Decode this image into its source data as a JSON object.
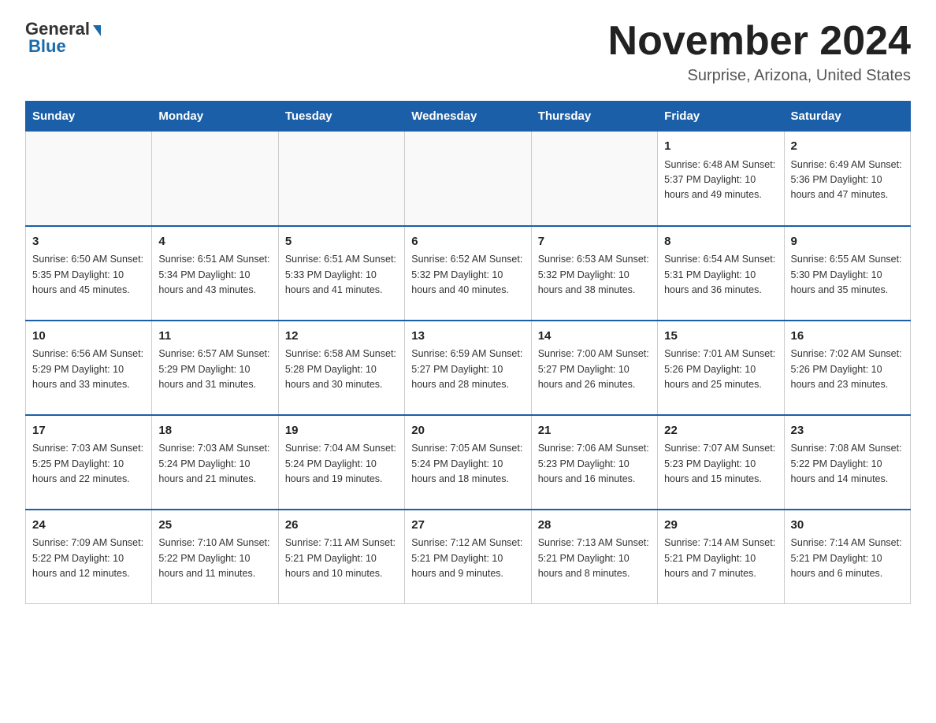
{
  "header": {
    "logo_general": "General",
    "logo_blue": "Blue",
    "month_title": "November 2024",
    "location": "Surprise, Arizona, United States"
  },
  "days_of_week": [
    "Sunday",
    "Monday",
    "Tuesday",
    "Wednesday",
    "Thursday",
    "Friday",
    "Saturday"
  ],
  "weeks": [
    [
      {
        "day": "",
        "info": ""
      },
      {
        "day": "",
        "info": ""
      },
      {
        "day": "",
        "info": ""
      },
      {
        "day": "",
        "info": ""
      },
      {
        "day": "",
        "info": ""
      },
      {
        "day": "1",
        "info": "Sunrise: 6:48 AM\nSunset: 5:37 PM\nDaylight: 10 hours and 49 minutes."
      },
      {
        "day": "2",
        "info": "Sunrise: 6:49 AM\nSunset: 5:36 PM\nDaylight: 10 hours and 47 minutes."
      }
    ],
    [
      {
        "day": "3",
        "info": "Sunrise: 6:50 AM\nSunset: 5:35 PM\nDaylight: 10 hours and 45 minutes."
      },
      {
        "day": "4",
        "info": "Sunrise: 6:51 AM\nSunset: 5:34 PM\nDaylight: 10 hours and 43 minutes."
      },
      {
        "day": "5",
        "info": "Sunrise: 6:51 AM\nSunset: 5:33 PM\nDaylight: 10 hours and 41 minutes."
      },
      {
        "day": "6",
        "info": "Sunrise: 6:52 AM\nSunset: 5:32 PM\nDaylight: 10 hours and 40 minutes."
      },
      {
        "day": "7",
        "info": "Sunrise: 6:53 AM\nSunset: 5:32 PM\nDaylight: 10 hours and 38 minutes."
      },
      {
        "day": "8",
        "info": "Sunrise: 6:54 AM\nSunset: 5:31 PM\nDaylight: 10 hours and 36 minutes."
      },
      {
        "day": "9",
        "info": "Sunrise: 6:55 AM\nSunset: 5:30 PM\nDaylight: 10 hours and 35 minutes."
      }
    ],
    [
      {
        "day": "10",
        "info": "Sunrise: 6:56 AM\nSunset: 5:29 PM\nDaylight: 10 hours and 33 minutes."
      },
      {
        "day": "11",
        "info": "Sunrise: 6:57 AM\nSunset: 5:29 PM\nDaylight: 10 hours and 31 minutes."
      },
      {
        "day": "12",
        "info": "Sunrise: 6:58 AM\nSunset: 5:28 PM\nDaylight: 10 hours and 30 minutes."
      },
      {
        "day": "13",
        "info": "Sunrise: 6:59 AM\nSunset: 5:27 PM\nDaylight: 10 hours and 28 minutes."
      },
      {
        "day": "14",
        "info": "Sunrise: 7:00 AM\nSunset: 5:27 PM\nDaylight: 10 hours and 26 minutes."
      },
      {
        "day": "15",
        "info": "Sunrise: 7:01 AM\nSunset: 5:26 PM\nDaylight: 10 hours and 25 minutes."
      },
      {
        "day": "16",
        "info": "Sunrise: 7:02 AM\nSunset: 5:26 PM\nDaylight: 10 hours and 23 minutes."
      }
    ],
    [
      {
        "day": "17",
        "info": "Sunrise: 7:03 AM\nSunset: 5:25 PM\nDaylight: 10 hours and 22 minutes."
      },
      {
        "day": "18",
        "info": "Sunrise: 7:03 AM\nSunset: 5:24 PM\nDaylight: 10 hours and 21 minutes."
      },
      {
        "day": "19",
        "info": "Sunrise: 7:04 AM\nSunset: 5:24 PM\nDaylight: 10 hours and 19 minutes."
      },
      {
        "day": "20",
        "info": "Sunrise: 7:05 AM\nSunset: 5:24 PM\nDaylight: 10 hours and 18 minutes."
      },
      {
        "day": "21",
        "info": "Sunrise: 7:06 AM\nSunset: 5:23 PM\nDaylight: 10 hours and 16 minutes."
      },
      {
        "day": "22",
        "info": "Sunrise: 7:07 AM\nSunset: 5:23 PM\nDaylight: 10 hours and 15 minutes."
      },
      {
        "day": "23",
        "info": "Sunrise: 7:08 AM\nSunset: 5:22 PM\nDaylight: 10 hours and 14 minutes."
      }
    ],
    [
      {
        "day": "24",
        "info": "Sunrise: 7:09 AM\nSunset: 5:22 PM\nDaylight: 10 hours and 12 minutes."
      },
      {
        "day": "25",
        "info": "Sunrise: 7:10 AM\nSunset: 5:22 PM\nDaylight: 10 hours and 11 minutes."
      },
      {
        "day": "26",
        "info": "Sunrise: 7:11 AM\nSunset: 5:21 PM\nDaylight: 10 hours and 10 minutes."
      },
      {
        "day": "27",
        "info": "Sunrise: 7:12 AM\nSunset: 5:21 PM\nDaylight: 10 hours and 9 minutes."
      },
      {
        "day": "28",
        "info": "Sunrise: 7:13 AM\nSunset: 5:21 PM\nDaylight: 10 hours and 8 minutes."
      },
      {
        "day": "29",
        "info": "Sunrise: 7:14 AM\nSunset: 5:21 PM\nDaylight: 10 hours and 7 minutes."
      },
      {
        "day": "30",
        "info": "Sunrise: 7:14 AM\nSunset: 5:21 PM\nDaylight: 10 hours and 6 minutes."
      }
    ]
  ]
}
